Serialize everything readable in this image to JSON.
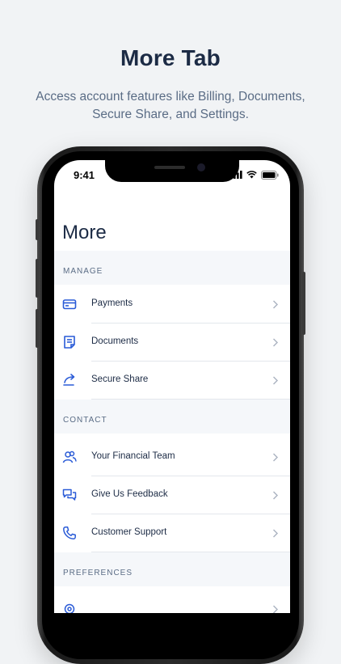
{
  "promo": {
    "title": "More Tab",
    "subtitle": "Access account features like Billing, Documents, Secure Share, and Settings."
  },
  "status_bar": {
    "time": "9:41"
  },
  "screen": {
    "title": "More",
    "sections": [
      {
        "header": "MANAGE",
        "items": [
          {
            "label": "Payments",
            "icon": "card-icon"
          },
          {
            "label": "Documents",
            "icon": "document-icon"
          },
          {
            "label": "Secure Share",
            "icon": "share-icon"
          }
        ]
      },
      {
        "header": "CONTACT",
        "items": [
          {
            "label": "Your Financial Team",
            "icon": "team-icon"
          },
          {
            "label": "Give Us Feedback",
            "icon": "feedback-icon"
          },
          {
            "label": "Customer Support",
            "icon": "phone-icon"
          }
        ]
      },
      {
        "header": "PREFERENCES",
        "items": []
      }
    ]
  },
  "colors": {
    "accent": "#2a5bd7",
    "text": "#1c2b45",
    "muted": "#5a6c85",
    "section_bg": "#f5f7fa"
  }
}
